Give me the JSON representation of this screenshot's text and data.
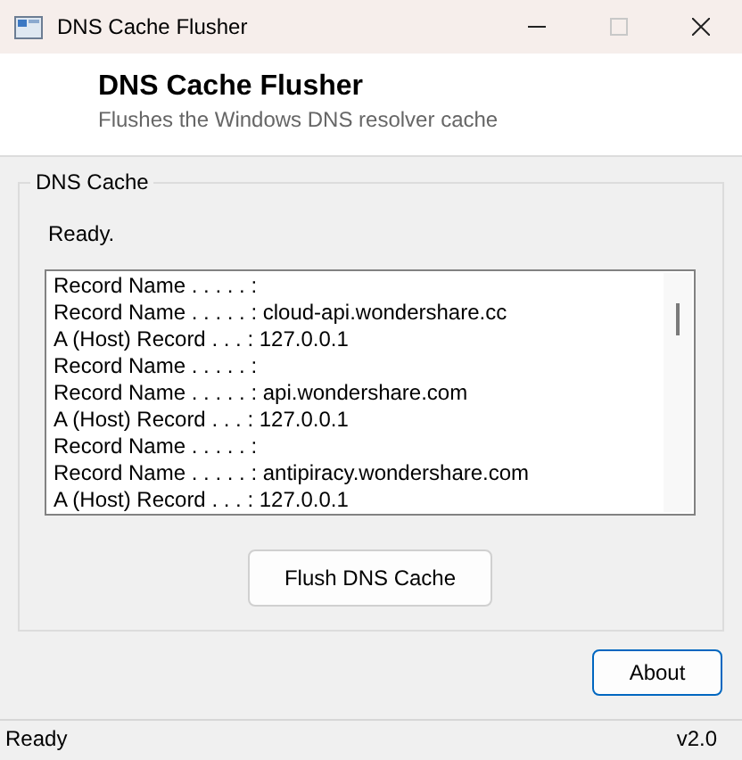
{
  "window": {
    "title": "DNS Cache Flusher",
    "controls": [
      {
        "kind": "minimize",
        "disabled": false
      },
      {
        "kind": "maximize",
        "disabled": true
      },
      {
        "kind": "close",
        "disabled": false
      }
    ]
  },
  "header": {
    "title": "DNS Cache Flusher",
    "subtitle": "Flushes the Windows DNS resolver cache"
  },
  "group": {
    "label": "DNS Cache",
    "status": "Ready.",
    "records": [
      "Record Name . . . . . :",
      "Record Name . . . . . : cloud-api.wondershare.cc",
      "A (Host) Record . . . : 127.0.0.1",
      "Record Name . . . . . :",
      "Record Name . . . . . : api.wondershare.com",
      "A (Host) Record . . . : 127.0.0.1",
      "Record Name . . . . . :",
      "Record Name . . . . . : antipiracy.wondershare.com",
      "A (Host) Record . . . : 127.0.0.1"
    ],
    "button": "Flush DNS Cache"
  },
  "about_button": "About",
  "status_bar": {
    "text": "Ready",
    "version": "v2.0"
  }
}
